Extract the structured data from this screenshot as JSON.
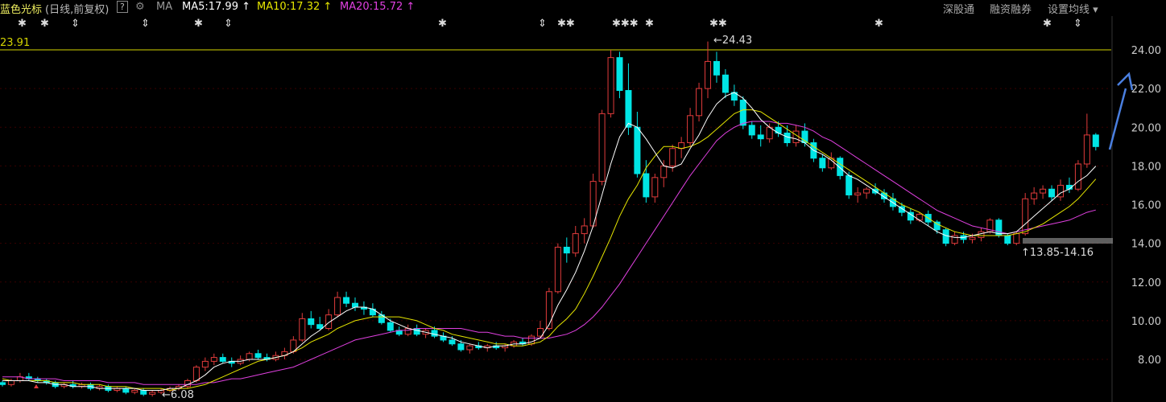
{
  "header": {
    "stock_name": "蓝色光标",
    "period": "(日线,前复权)",
    "help": "?",
    "ma_label": "MA",
    "ma5": "MA5:17.99",
    "ma10": "MA10:17.32",
    "ma20": "MA20:15.72",
    "arrow": "↑",
    "menu_shgt": "深股通",
    "menu_rzrq": "融资融券",
    "menu_settings": "设置均线",
    "menu_caret": "▾"
  },
  "colors": {
    "up": "#e03b3b",
    "down": "#00e5e5",
    "ma5": "#ffffff",
    "ma10": "#e5e500",
    "ma20": "#e040e0",
    "grid": "#3a0000",
    "hline": "#d4d400",
    "axis_text": "#cccccc",
    "annotation_arrow": "#4a7fe0"
  },
  "markers": [
    "✱",
    "✱",
    "⇕",
    "⇕",
    "✱",
    "⇕",
    "✱",
    "⇕",
    "✱✱",
    "✱✱✱",
    "✱",
    "✱✱",
    "✱",
    "✱",
    "⇕"
  ],
  "chart_data": {
    "type": "candlestick",
    "y_axis": {
      "ticks": [
        "24.00",
        "22.00",
        "20.00",
        "18.00",
        "16.00",
        "14.00",
        "12.00",
        "10.00",
        "8.00"
      ],
      "range": [
        5.8,
        25.3
      ]
    },
    "annotations": {
      "high_line_label": "23.91",
      "high_label": "24.43",
      "low_label": "6.08",
      "range_label": "13.85-14.16"
    },
    "candles": [
      [
        6.8,
        6.9,
        6.6,
        6.7
      ],
      [
        6.7,
        7.0,
        6.6,
        6.9
      ],
      [
        6.9,
        7.3,
        6.8,
        7.1
      ],
      [
        7.1,
        7.3,
        6.9,
        7.0
      ],
      [
        7.0,
        7.1,
        6.8,
        6.9
      ],
      [
        6.9,
        7.0,
        6.7,
        6.8
      ],
      [
        6.8,
        6.9,
        6.5,
        6.6
      ],
      [
        6.6,
        6.8,
        6.5,
        6.7
      ],
      [
        6.7,
        6.9,
        6.5,
        6.6
      ],
      [
        6.6,
        6.8,
        6.5,
        6.7
      ],
      [
        6.7,
        6.8,
        6.4,
        6.5
      ],
      [
        6.5,
        6.7,
        6.4,
        6.6
      ],
      [
        6.6,
        6.7,
        6.3,
        6.4
      ],
      [
        6.4,
        6.6,
        6.3,
        6.5
      ],
      [
        6.5,
        6.6,
        6.2,
        6.3
      ],
      [
        6.3,
        6.5,
        6.2,
        6.4
      ],
      [
        6.4,
        6.5,
        6.1,
        6.2
      ],
      [
        6.2,
        6.4,
        6.08,
        6.3
      ],
      [
        6.3,
        6.5,
        6.2,
        6.4
      ],
      [
        6.4,
        6.6,
        6.3,
        6.5
      ],
      [
        6.5,
        6.7,
        6.4,
        6.6
      ],
      [
        6.6,
        7.0,
        6.5,
        6.9
      ],
      [
        6.9,
        7.7,
        6.8,
        7.6
      ],
      [
        7.6,
        8.1,
        7.4,
        7.9
      ],
      [
        7.9,
        8.3,
        7.7,
        8.1
      ],
      [
        8.1,
        8.3,
        7.8,
        7.9
      ],
      [
        7.9,
        8.1,
        7.6,
        7.8
      ],
      [
        7.8,
        8.2,
        7.7,
        8.0
      ],
      [
        8.0,
        8.4,
        7.9,
        8.3
      ],
      [
        8.3,
        8.5,
        8.0,
        8.1
      ],
      [
        8.1,
        8.3,
        7.9,
        8.0
      ],
      [
        8.0,
        8.4,
        7.9,
        8.2
      ],
      [
        8.2,
        8.6,
        8.0,
        8.4
      ],
      [
        8.4,
        9.2,
        8.3,
        9.0
      ],
      [
        9.0,
        10.4,
        8.9,
        10.1
      ],
      [
        10.1,
        10.5,
        9.6,
        9.8
      ],
      [
        9.8,
        10.2,
        9.5,
        9.6
      ],
      [
        9.6,
        10.6,
        9.5,
        10.3
      ],
      [
        10.3,
        11.5,
        10.2,
        11.2
      ],
      [
        11.2,
        11.5,
        10.7,
        10.9
      ],
      [
        10.9,
        11.2,
        10.5,
        10.7
      ],
      [
        10.7,
        11.0,
        10.3,
        10.6
      ],
      [
        10.6,
        10.9,
        10.2,
        10.3
      ],
      [
        10.3,
        10.5,
        9.8,
        9.9
      ],
      [
        9.9,
        10.1,
        9.4,
        9.5
      ],
      [
        9.5,
        9.7,
        9.2,
        9.3
      ],
      [
        9.3,
        9.8,
        9.2,
        9.6
      ],
      [
        9.6,
        9.8,
        9.2,
        9.3
      ],
      [
        9.3,
        9.6,
        9.1,
        9.5
      ],
      [
        9.5,
        9.7,
        9.1,
        9.2
      ],
      [
        9.2,
        9.4,
        8.9,
        9.0
      ],
      [
        9.0,
        9.2,
        8.7,
        8.8
      ],
      [
        8.8,
        9.0,
        8.4,
        8.5
      ],
      [
        8.5,
        8.8,
        8.3,
        8.7
      ],
      [
        8.7,
        8.9,
        8.5,
        8.6
      ],
      [
        8.6,
        8.8,
        8.4,
        8.7
      ],
      [
        8.7,
        8.9,
        8.5,
        8.6
      ],
      [
        8.6,
        8.8,
        8.4,
        8.7
      ],
      [
        8.7,
        9.0,
        8.6,
        8.9
      ],
      [
        8.9,
        9.1,
        8.7,
        8.8
      ],
      [
        8.8,
        9.3,
        8.7,
        9.2
      ],
      [
        9.2,
        10.0,
        9.1,
        9.6
      ],
      [
        9.6,
        11.7,
        9.5,
        11.5
      ],
      [
        11.5,
        14.0,
        11.4,
        13.8
      ],
      [
        13.8,
        14.3,
        13.0,
        13.5
      ],
      [
        13.5,
        14.9,
        13.3,
        14.5
      ],
      [
        14.5,
        15.3,
        14.0,
        14.9
      ],
      [
        14.9,
        17.6,
        14.8,
        17.2
      ],
      [
        17.2,
        20.9,
        17.0,
        20.7
      ],
      [
        20.7,
        24.0,
        20.5,
        23.6
      ],
      [
        23.6,
        23.9,
        21.5,
        21.9
      ],
      [
        21.9,
        23.3,
        19.6,
        20.0
      ],
      [
        20.0,
        20.8,
        17.4,
        17.6
      ],
      [
        17.6,
        18.3,
        16.1,
        16.4
      ],
      [
        16.4,
        17.6,
        16.1,
        17.4
      ],
      [
        17.4,
        18.3,
        16.9,
        18.0
      ],
      [
        18.0,
        19.1,
        17.7,
        18.9
      ],
      [
        18.9,
        19.5,
        18.4,
        19.2
      ],
      [
        19.2,
        21.0,
        19.0,
        20.6
      ],
      [
        20.6,
        22.3,
        20.3,
        22.0
      ],
      [
        22.0,
        24.43,
        21.5,
        23.4
      ],
      [
        23.4,
        23.9,
        22.3,
        22.7
      ],
      [
        22.7,
        23.0,
        21.5,
        21.8
      ],
      [
        21.8,
        22.2,
        21.1,
        21.4
      ],
      [
        21.4,
        21.6,
        19.9,
        20.1
      ],
      [
        20.1,
        20.3,
        19.4,
        19.6
      ],
      [
        19.6,
        20.1,
        19.0,
        19.4
      ],
      [
        19.4,
        20.2,
        19.2,
        20.0
      ],
      [
        20.0,
        20.3,
        19.5,
        19.7
      ],
      [
        19.7,
        20.1,
        19.0,
        19.2
      ],
      [
        19.2,
        20.1,
        19.0,
        19.8
      ],
      [
        19.8,
        20.2,
        19.0,
        19.2
      ],
      [
        19.2,
        19.4,
        18.2,
        18.4
      ],
      [
        18.4,
        18.6,
        17.7,
        17.9
      ],
      [
        17.9,
        18.7,
        17.8,
        18.4
      ],
      [
        18.4,
        18.5,
        17.3,
        17.5
      ],
      [
        17.5,
        17.7,
        16.3,
        16.5
      ],
      [
        16.5,
        16.9,
        16.1,
        16.6
      ],
      [
        16.6,
        16.9,
        16.3,
        16.8
      ],
      [
        16.8,
        17.1,
        16.5,
        16.6
      ],
      [
        16.6,
        16.8,
        16.1,
        16.3
      ],
      [
        16.3,
        16.6,
        15.7,
        15.9
      ],
      [
        15.9,
        16.1,
        15.4,
        15.6
      ],
      [
        15.6,
        15.8,
        15.0,
        15.2
      ],
      [
        15.2,
        15.6,
        15.1,
        15.5
      ],
      [
        15.5,
        15.7,
        14.9,
        15.1
      ],
      [
        15.1,
        15.2,
        14.5,
        14.7
      ],
      [
        14.7,
        14.8,
        13.85,
        14.0
      ],
      [
        14.0,
        14.6,
        13.9,
        14.4
      ],
      [
        14.4,
        14.6,
        14.0,
        14.2
      ],
      [
        14.2,
        14.5,
        14.0,
        14.3
      ],
      [
        14.3,
        14.8,
        14.1,
        14.6
      ],
      [
        14.6,
        15.3,
        14.5,
        15.2
      ],
      [
        15.2,
        15.3,
        14.3,
        14.4
      ],
      [
        14.4,
        14.5,
        13.9,
        14.0
      ],
      [
        14.0,
        14.6,
        13.9,
        14.5
      ],
      [
        14.5,
        16.6,
        14.4,
        16.3
      ],
      [
        16.3,
        16.9,
        16.0,
        16.6
      ],
      [
        16.6,
        17.0,
        16.3,
        16.8
      ],
      [
        16.8,
        17.0,
        16.2,
        16.4
      ],
      [
        16.4,
        17.3,
        16.2,
        17.0
      ],
      [
        17.0,
        17.4,
        16.6,
        16.8
      ],
      [
        16.8,
        18.3,
        16.7,
        18.1
      ],
      [
        18.1,
        20.7,
        17.9,
        19.6
      ],
      [
        19.6,
        19.7,
        18.8,
        19.0
      ]
    ],
    "ma5": [
      6.9,
      6.9,
      6.9,
      6.9,
      6.8,
      6.8,
      6.7,
      6.7,
      6.6,
      6.6,
      6.6,
      6.5,
      6.5,
      6.5,
      6.5,
      6.5,
      6.4,
      6.4,
      6.4,
      6.5,
      6.5,
      6.7,
      6.9,
      7.2,
      7.6,
      7.8,
      7.9,
      7.9,
      8.0,
      8.0,
      8.0,
      8.1,
      8.2,
      8.4,
      8.8,
      9.2,
      9.5,
      9.9,
      10.2,
      10.5,
      10.7,
      10.7,
      10.6,
      10.3,
      10.0,
      9.8,
      9.6,
      9.5,
      9.4,
      9.3,
      9.2,
      9.1,
      8.9,
      8.8,
      8.7,
      8.6,
      8.7,
      8.7,
      8.8,
      8.8,
      8.9,
      9.1,
      9.8,
      10.8,
      11.6,
      12.5,
      13.6,
      14.9,
      16.5,
      18.1,
      19.5,
      20.2,
      20.0,
      19.4,
      18.7,
      18.0,
      17.9,
      18.1,
      18.9,
      19.6,
      20.5,
      21.2,
      21.6,
      21.8,
      21.5,
      21.0,
      20.4,
      20.0,
      19.7,
      19.5,
      19.4,
      19.2,
      18.8,
      18.6,
      18.3,
      17.9,
      17.5,
      17.3,
      17.0,
      16.7,
      16.4,
      16.1,
      15.8,
      15.5,
      15.2,
      14.9,
      14.6,
      14.4,
      14.3,
      14.3,
      14.4,
      14.5,
      14.6,
      14.5,
      14.5,
      14.6,
      15.0,
      15.4,
      15.8,
      16.2,
      16.6,
      16.8,
      17.2,
      17.5,
      17.99
    ],
    "ma10": [
      7.0,
      6.9,
      6.9,
      6.9,
      6.9,
      6.9,
      6.8,
      6.8,
      6.8,
      6.7,
      6.7,
      6.7,
      6.6,
      6.6,
      6.6,
      6.5,
      6.5,
      6.5,
      6.5,
      6.4,
      6.5,
      6.5,
      6.6,
      6.7,
      6.9,
      7.1,
      7.3,
      7.5,
      7.7,
      7.9,
      8.0,
      8.1,
      8.2,
      8.4,
      8.6,
      8.9,
      9.1,
      9.3,
      9.6,
      9.8,
      10.0,
      10.1,
      10.2,
      10.2,
      10.2,
      10.2,
      10.1,
      10.0,
      9.8,
      9.6,
      9.5,
      9.3,
      9.2,
      9.1,
      9.0,
      8.9,
      8.8,
      8.8,
      8.7,
      8.7,
      8.8,
      8.9,
      9.2,
      9.7,
      10.1,
      10.6,
      11.4,
      12.3,
      13.3,
      14.3,
      15.4,
      16.3,
      17.0,
      17.9,
      18.5,
      19.0,
      19.0,
      18.9,
      19.0,
      19.2,
      19.5,
      19.9,
      20.3,
      20.7,
      20.9,
      20.9,
      20.8,
      20.5,
      20.2,
      19.9,
      19.6,
      19.3,
      19.0,
      18.7,
      18.4,
      18.1,
      17.8,
      17.5,
      17.2,
      16.9,
      16.6,
      16.3,
      16.0,
      15.8,
      15.6,
      15.3,
      15.0,
      14.8,
      14.6,
      14.5,
      14.4,
      14.4,
      14.4,
      14.4,
      14.4,
      14.5,
      14.6,
      14.8,
      15.0,
      15.3,
      15.6,
      15.9,
      16.3,
      16.8,
      17.32
    ],
    "ma20": [
      7.1,
      7.1,
      7.1,
      7.0,
      7.0,
      7.0,
      7.0,
      6.9,
      6.9,
      6.9,
      6.9,
      6.9,
      6.8,
      6.8,
      6.8,
      6.8,
      6.7,
      6.7,
      6.7,
      6.7,
      6.7,
      6.7,
      6.7,
      6.8,
      6.8,
      6.9,
      7.0,
      7.0,
      7.1,
      7.2,
      7.3,
      7.4,
      7.5,
      7.6,
      7.8,
      8.0,
      8.2,
      8.4,
      8.6,
      8.8,
      9.0,
      9.1,
      9.2,
      9.3,
      9.4,
      9.5,
      9.5,
      9.6,
      9.6,
      9.6,
      9.6,
      9.6,
      9.6,
      9.5,
      9.4,
      9.4,
      9.3,
      9.2,
      9.2,
      9.1,
      9.1,
      9.1,
      9.1,
      9.2,
      9.3,
      9.5,
      9.8,
      10.2,
      10.7,
      11.3,
      11.9,
      12.6,
      13.3,
      14.0,
      14.7,
      15.4,
      16.1,
      16.8,
      17.5,
      18.1,
      18.7,
      19.3,
      19.7,
      20.0,
      20.2,
      20.3,
      20.3,
      20.3,
      20.2,
      20.2,
      20.1,
      20.0,
      19.8,
      19.5,
      19.3,
      19.0,
      18.7,
      18.4,
      18.1,
      17.8,
      17.5,
      17.2,
      16.9,
      16.6,
      16.3,
      16.0,
      15.7,
      15.5,
      15.3,
      15.1,
      14.9,
      14.8,
      14.7,
      14.6,
      14.5,
      14.6,
      14.7,
      14.8,
      14.9,
      15.0,
      15.1,
      15.2,
      15.4,
      15.6,
      15.72
    ]
  }
}
